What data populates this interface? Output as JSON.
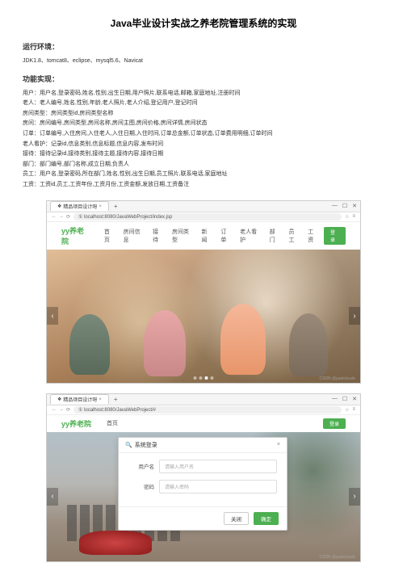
{
  "title": "Java毕业设计实战之养老院管理系统的实现",
  "section1": {
    "heading": "运行环境：",
    "text": "JDK1.8、tomcat8、eclipse、mysql5.6、Navicat"
  },
  "section2": {
    "heading": "功能实现：",
    "lines": [
      "用户：用户名,登录密码,姓名,性别,出生日期,用户照片,联系电话,邮箱,家庭地址,注册时间",
      "老人：老人编号,姓名,性别,年龄,老人照片,老人介绍,登记用户,登记时间",
      "房间类型：房间类型id,房间类型名称",
      "房间：房间编号,房间类型,房间名称,房间主图,房间价格,房间详情,房间状态",
      "订单：订单编号,入住房间,入住老人,入住日期,入住时间,订单总金额,订单状态,订单费用明细,订单时间",
      "老人看护：记录id,信息类别,信息标题,信息内容,发布时间",
      "接待：接待记录id,接待类别,接待主题,接待内容,接待日期",
      "部门：部门编号,部门名称,成立日期,负责人",
      "员工：用户名,登录密码,所在部门,姓名,性别,出生日期,员工照片,联系电话,家庭地址",
      "工资：工资id,员工,工资年份,工资月份,工资金额,发放日期,工资备注"
    ]
  },
  "browser": {
    "tab_title": "精品项目设计呀",
    "url1": "localhost:8080/JavaWebProject/index.jsp",
    "url2": "localhost:8080/JavaWebProject/#"
  },
  "site": {
    "logo": "yy养老院",
    "nav": [
      "首页",
      "房间信息",
      "接待",
      "房间类型",
      "新闻",
      "订单",
      "老人看护",
      "部门",
      "员工",
      "工资"
    ],
    "login": "登录"
  },
  "modal": {
    "title": "系统登录",
    "user_label": "用户名",
    "user_placeholder": "请输入用户名",
    "pass_label": "密码",
    "pass_placeholder": "请输入密码",
    "close_btn": "关闭",
    "ok_btn": "确定"
  },
  "watermark": "CSDN @pastclouds"
}
